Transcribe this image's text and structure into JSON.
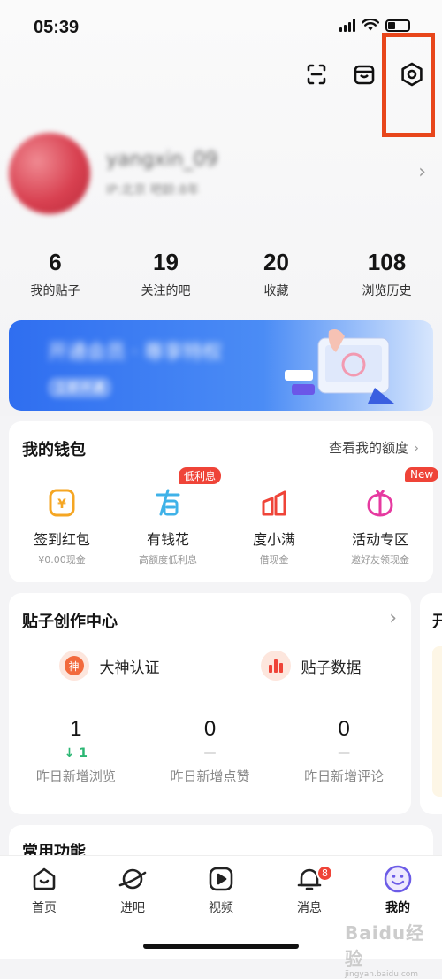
{
  "status_bar": {
    "time": "05:39"
  },
  "profile": {
    "username": "yangxin_09",
    "meta": "IP:北京  吧龄:8年"
  },
  "stats": [
    {
      "value": "6",
      "label": "我的贴子"
    },
    {
      "value": "19",
      "label": "关注的吧"
    },
    {
      "value": "20",
      "label": "收藏"
    },
    {
      "value": "108",
      "label": "浏览历史"
    }
  ],
  "banner": {
    "title": "开通会员 · 尊享特权",
    "subtitle": "立即开通"
  },
  "wallet": {
    "title": "我的钱包",
    "link": "查看我的额度",
    "items": [
      {
        "label": "签到红包",
        "sub": "¥0.00现金",
        "icon": "red-envelope-icon",
        "color": "#f5a623"
      },
      {
        "label": "有钱花",
        "sub": "高额度低利息",
        "icon": "youqianhua-icon",
        "color": "#3fb2e8",
        "badge": "低利息"
      },
      {
        "label": "度小满",
        "sub": "借现金",
        "icon": "duxiaoman-icon",
        "color": "#ef4438"
      },
      {
        "label": "活动专区",
        "sub": "邀好友领现金",
        "icon": "gift-icon",
        "color": "#e63aa0",
        "badge": "New"
      }
    ]
  },
  "creation": {
    "title": "贴子创作中心",
    "left": {
      "label": "大神认证",
      "icon_text": "神"
    },
    "right": {
      "label": "贴子数据"
    },
    "metrics": [
      {
        "value": "1",
        "delta": "↓ 1",
        "label": "昨日新增浏览"
      },
      {
        "value": "0",
        "delta": "—",
        "label": "昨日新增点赞"
      },
      {
        "value": "0",
        "delta": "—",
        "label": "昨日新增评论"
      }
    ]
  },
  "side_card": {
    "title": "开"
  },
  "common": {
    "title": "常用功能"
  },
  "tabbar": {
    "tabs": [
      {
        "label": "首页",
        "icon": "home-icon"
      },
      {
        "label": "进吧",
        "icon": "planet-icon"
      },
      {
        "label": "视频",
        "icon": "video-icon"
      },
      {
        "label": "消息",
        "icon": "bell-icon",
        "badge": "8"
      },
      {
        "label": "我的",
        "icon": "smiley-icon",
        "active": true
      }
    ]
  },
  "watermark": {
    "brand": "Baidu经验",
    "url": "jingyan.baidu.com"
  },
  "colors": {
    "accent": "#ef4438",
    "highlight": "#e8461b",
    "active_tab": "#6c5ce7",
    "up": "#2bb673"
  }
}
